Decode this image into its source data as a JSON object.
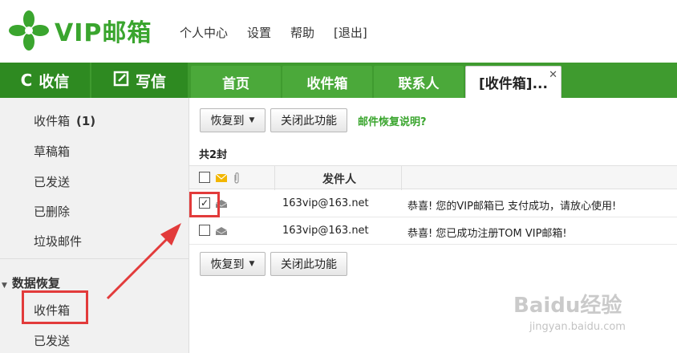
{
  "logo": {
    "text": "VIP邮箱",
    "icon": "green-clover-icon",
    "brand_color": "#3aa52e"
  },
  "top_links": [
    "个人中心",
    "设置",
    "帮助",
    "[退出]"
  ],
  "nav": {
    "receive_label": "收信",
    "write_label": "写信",
    "tabs": [
      "首页",
      "收件箱",
      "联系人",
      "[收件箱]..."
    ],
    "close_symbol": "✕"
  },
  "sidebar": {
    "items": [
      {
        "label": "收件箱",
        "count": "(1)"
      },
      {
        "label": "草稿箱"
      },
      {
        "label": "已发送"
      },
      {
        "label": "已删除"
      },
      {
        "label": "垃圾邮件"
      }
    ],
    "section_title": "数据恢复",
    "section_items": [
      "收件箱",
      "已发送"
    ]
  },
  "toolbar": {
    "restore_label": "恢复到",
    "close_feature_label": "关闭此功能",
    "help_link": "邮件恢复说明?"
  },
  "list": {
    "count_text": "共2封",
    "sender_header": "发件人",
    "rows": [
      {
        "checked": true,
        "sender": "163vip@163.net",
        "subject": "恭喜! 您的VIP邮箱已 支付成功，请放心使用!"
      },
      {
        "checked": false,
        "sender": "163vip@163.net",
        "subject": "恭喜! 您已成功注册TOM VIP邮箱!"
      }
    ]
  },
  "watermark": {
    "brand": "Baidu经验",
    "url": "jingyan.baidu.com"
  }
}
